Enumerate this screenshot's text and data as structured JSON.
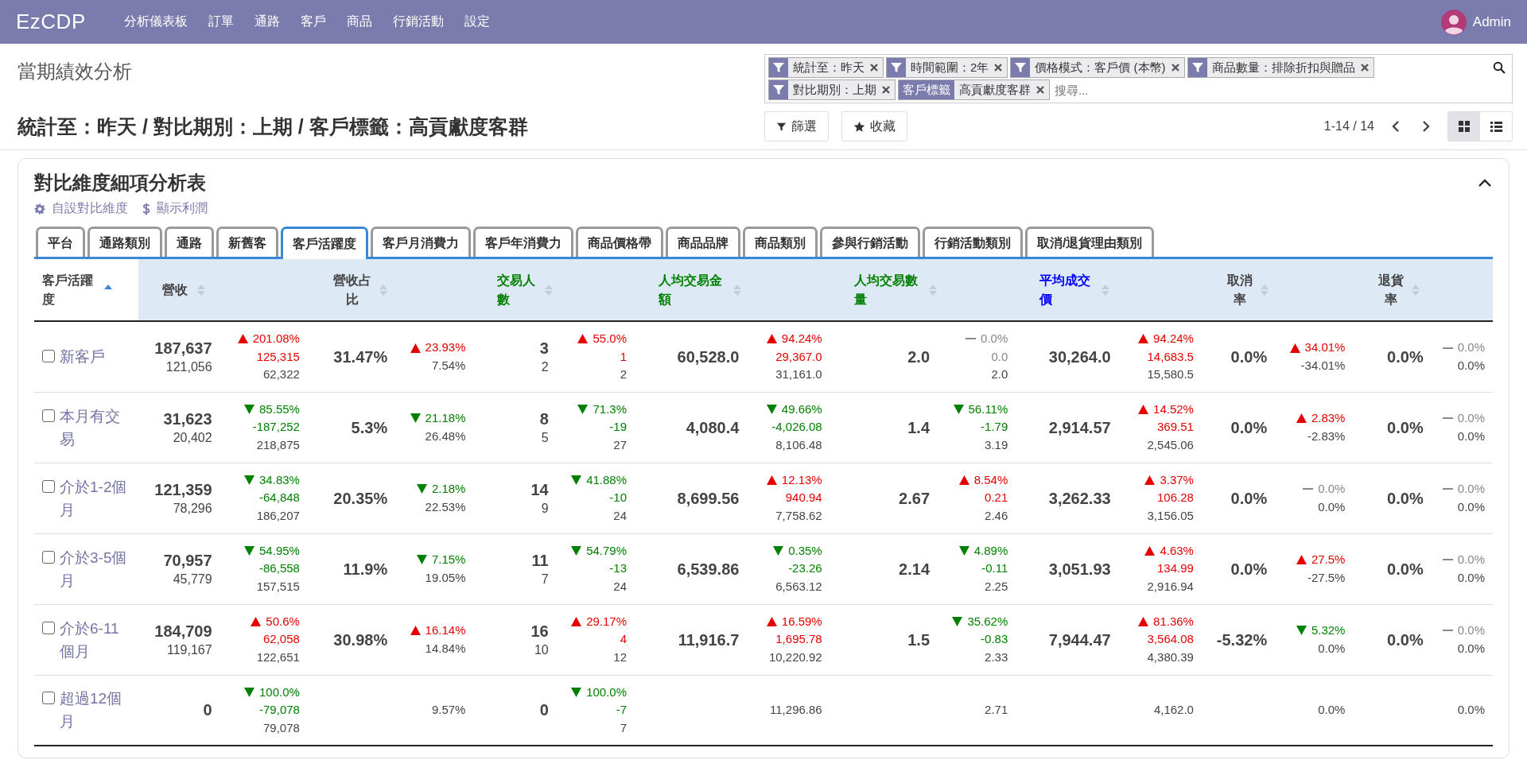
{
  "navbar": {
    "brand": "EzCDP",
    "menu": [
      "分析儀表板",
      "訂單",
      "通路",
      "客戶",
      "商品",
      "行銷活動",
      "設定"
    ],
    "user": "Admin"
  },
  "control_panel": {
    "title": "當期績效分析",
    "heading": "統計至：昨天 / 對比期別：上期 / 客戶標籤：高貢獻度客群",
    "facets": [
      {
        "kind": "filter",
        "text": "統計至：昨天"
      },
      {
        "kind": "filter",
        "text": "時間範圍：2年"
      },
      {
        "kind": "filter",
        "text": "價格模式：客戶價 (本幣)"
      },
      {
        "kind": "filter",
        "text": "商品數量：排除折扣與贈品"
      },
      {
        "kind": "filter",
        "text": "對比期別：上期"
      },
      {
        "kind": "tag",
        "label": "客戶標籤",
        "text": "高貢獻度客群"
      }
    ],
    "search_placeholder": "搜尋...",
    "buttons": [
      {
        "kind": "filter",
        "label": "篩選"
      },
      {
        "kind": "favorite",
        "label": "收藏"
      }
    ],
    "pager": "1-14 / 14",
    "views": [
      {
        "kind": "kanban",
        "selected": true
      },
      {
        "kind": "list",
        "selected": false
      }
    ]
  },
  "card": {
    "title": "對比維度細項分析表",
    "expanded": true,
    "links": [
      {
        "kind": "gear",
        "label": "自設對比維度"
      },
      {
        "kind": "dollar",
        "label": "顯示利潤"
      }
    ],
    "tabs": [
      {
        "label": "平台",
        "selected": false
      },
      {
        "label": "通路類別",
        "selected": false
      },
      {
        "label": "通路",
        "selected": false
      },
      {
        "label": "新舊客",
        "selected": false
      },
      {
        "label": "客戶活躍度",
        "selected": true
      },
      {
        "label": "客戶月消費力",
        "selected": false
      },
      {
        "label": "客戶年消費力",
        "selected": false
      },
      {
        "label": "商品價格帶",
        "selected": false
      },
      {
        "label": "商品品牌",
        "selected": false
      },
      {
        "label": "商品類別",
        "selected": false
      },
      {
        "label": "參與行銷活動",
        "selected": false
      },
      {
        "label": "行銷活動類別",
        "selected": false
      },
      {
        "label": "取消/退貨理由類別",
        "selected": false
      }
    ],
    "table": {
      "label_column": {
        "label": "客戶活躍度",
        "sorted": true
      },
      "columns": [
        {
          "label": "營收",
          "sorted": false,
          "color": "#444444"
        },
        {
          "label": "營收占比",
          "sorted": false,
          "color": "#444444"
        },
        {
          "label": "交易人數",
          "sorted": false,
          "color": "#008000"
        },
        {
          "label": "人均交易金額",
          "sorted": false,
          "color": "#008000"
        },
        {
          "label": "人均交易數量",
          "sorted": false,
          "color": "#008000"
        },
        {
          "label": "平均成交價",
          "sorted": false,
          "color": "#0000ff"
        },
        {
          "label": "取消率",
          "sorted": false,
          "color": "#444444"
        },
        {
          "label": "退貨率",
          "sorted": false,
          "color": "#444444"
        }
      ],
      "rows": [
        {
          "label": "新客戶",
          "checked": false,
          "cells": [
            {
              "main": "187,637",
              "sub": "121,056",
              "delta": {
                "kind": "up",
                "pct": "201.08%",
                "diff": "125,315",
                "prior": "62,322"
              }
            },
            {
              "main": "31.47%",
              "delta": {
                "kind": "up",
                "pct": "23.93%",
                "prior": "7.54%"
              }
            },
            {
              "main": "3",
              "sub": "2",
              "delta": {
                "kind": "up",
                "pct": "55.0%",
                "diff": "1",
                "prior": "2"
              }
            },
            {
              "main": "60,528.0",
              "delta": {
                "kind": "up",
                "pct": "94.24%",
                "diff": "29,367.0",
                "prior": "31,161.0"
              }
            },
            {
              "main": "2.0",
              "delta": {
                "kind": "flat",
                "pct": "0.0%",
                "diff": "0.0",
                "prior": "2.0"
              }
            },
            {
              "main": "30,264.0",
              "delta": {
                "kind": "up",
                "pct": "94.24%",
                "diff": "14,683.5",
                "prior": "15,580.5"
              }
            },
            {
              "main": "0.0%",
              "delta": {
                "kind": "up",
                "pct": "34.01%",
                "prior": "-34.01%"
              }
            },
            {
              "main": "0.0%",
              "delta": {
                "kind": "flat",
                "pct": "0.0%",
                "prior": "0.0%"
              }
            }
          ]
        },
        {
          "label": "本月有交易",
          "checked": false,
          "cells": [
            {
              "main": "31,623",
              "sub": "20,402",
              "delta": {
                "kind": "down",
                "pct": "85.55%",
                "diff": "-187,252",
                "prior": "218,875"
              }
            },
            {
              "main": "5.3%",
              "delta": {
                "kind": "down",
                "pct": "21.18%",
                "prior": "26.48%"
              }
            },
            {
              "main": "8",
              "sub": "5",
              "delta": {
                "kind": "down",
                "pct": "71.3%",
                "diff": "-19",
                "prior": "27"
              }
            },
            {
              "main": "4,080.4",
              "delta": {
                "kind": "down",
                "pct": "49.66%",
                "diff": "-4,026.08",
                "prior": "8,106.48"
              }
            },
            {
              "main": "1.4",
              "delta": {
                "kind": "down",
                "pct": "56.11%",
                "diff": "-1.79",
                "prior": "3.19"
              }
            },
            {
              "main": "2,914.57",
              "delta": {
                "kind": "up",
                "pct": "14.52%",
                "diff": "369.51",
                "prior": "2,545.06"
              }
            },
            {
              "main": "0.0%",
              "delta": {
                "kind": "up",
                "pct": "2.83%",
                "prior": "-2.83%"
              }
            },
            {
              "main": "0.0%",
              "delta": {
                "kind": "flat",
                "pct": "0.0%",
                "prior": "0.0%"
              }
            }
          ]
        },
        {
          "label": "介於1-2個月",
          "checked": false,
          "cells": [
            {
              "main": "121,359",
              "sub": "78,296",
              "delta": {
                "kind": "down",
                "pct": "34.83%",
                "diff": "-64,848",
                "prior": "186,207"
              }
            },
            {
              "main": "20.35%",
              "delta": {
                "kind": "down",
                "pct": "2.18%",
                "prior": "22.53%"
              }
            },
            {
              "main": "14",
              "sub": "9",
              "delta": {
                "kind": "down",
                "pct": "41.88%",
                "diff": "-10",
                "prior": "24"
              }
            },
            {
              "main": "8,699.56",
              "delta": {
                "kind": "up",
                "pct": "12.13%",
                "diff": "940.94",
                "prior": "7,758.62"
              }
            },
            {
              "main": "2.67",
              "delta": {
                "kind": "up",
                "pct": "8.54%",
                "diff": "0.21",
                "prior": "2.46"
              }
            },
            {
              "main": "3,262.33",
              "delta": {
                "kind": "up",
                "pct": "3.37%",
                "diff": "106.28",
                "prior": "3,156.05"
              }
            },
            {
              "main": "0.0%",
              "delta": {
                "kind": "flat",
                "pct": "0.0%",
                "prior": "0.0%"
              }
            },
            {
              "main": "0.0%",
              "delta": {
                "kind": "flat",
                "pct": "0.0%",
                "prior": "0.0%"
              }
            }
          ]
        },
        {
          "label": "介於3-5個月",
          "checked": false,
          "cells": [
            {
              "main": "70,957",
              "sub": "45,779",
              "delta": {
                "kind": "down",
                "pct": "54.95%",
                "diff": "-86,558",
                "prior": "157,515"
              }
            },
            {
              "main": "11.9%",
              "delta": {
                "kind": "down",
                "pct": "7.15%",
                "prior": "19.05%"
              }
            },
            {
              "main": "11",
              "sub": "7",
              "delta": {
                "kind": "down",
                "pct": "54.79%",
                "diff": "-13",
                "prior": "24"
              }
            },
            {
              "main": "6,539.86",
              "delta": {
                "kind": "down",
                "pct": "0.35%",
                "diff": "-23.26",
                "prior": "6,563.12"
              }
            },
            {
              "main": "2.14",
              "delta": {
                "kind": "down",
                "pct": "4.89%",
                "diff": "-0.11",
                "prior": "2.25"
              }
            },
            {
              "main": "3,051.93",
              "delta": {
                "kind": "up",
                "pct": "4.63%",
                "diff": "134.99",
                "prior": "2,916.94"
              }
            },
            {
              "main": "0.0%",
              "delta": {
                "kind": "up",
                "pct": "27.5%",
                "prior": "-27.5%"
              }
            },
            {
              "main": "0.0%",
              "delta": {
                "kind": "flat",
                "pct": "0.0%",
                "prior": "0.0%"
              }
            }
          ]
        },
        {
          "label": "介於6-11個月",
          "checked": false,
          "cells": [
            {
              "main": "184,709",
              "sub": "119,167",
              "delta": {
                "kind": "up",
                "pct": "50.6%",
                "diff": "62,058",
                "prior": "122,651"
              }
            },
            {
              "main": "30.98%",
              "delta": {
                "kind": "up",
                "pct": "16.14%",
                "prior": "14.84%"
              }
            },
            {
              "main": "16",
              "sub": "10",
              "delta": {
                "kind": "up",
                "pct": "29.17%",
                "diff": "4",
                "prior": "12"
              }
            },
            {
              "main": "11,916.7",
              "delta": {
                "kind": "up",
                "pct": "16.59%",
                "diff": "1,695.78",
                "prior": "10,220.92"
              }
            },
            {
              "main": "1.5",
              "delta": {
                "kind": "down",
                "pct": "35.62%",
                "diff": "-0.83",
                "prior": "2.33"
              }
            },
            {
              "main": "7,944.47",
              "delta": {
                "kind": "up",
                "pct": "81.36%",
                "diff": "3,564.08",
                "prior": "4,380.39"
              }
            },
            {
              "main": "-5.32%",
              "delta": {
                "kind": "down",
                "pct": "5.32%",
                "prior": "0.0%"
              }
            },
            {
              "main": "0.0%",
              "delta": {
                "kind": "flat",
                "pct": "0.0%",
                "prior": "0.0%"
              }
            }
          ]
        },
        {
          "label": "超過12個月",
          "checked": false,
          "cells": [
            {
              "main": "0",
              "delta": {
                "kind": "down",
                "pct": "100.0%",
                "diff": "-79,078",
                "prior": "79,078"
              }
            },
            {
              "delta": {
                "kind": "none",
                "prior": "9.57%"
              }
            },
            {
              "main": "0",
              "delta": {
                "kind": "down",
                "pct": "100.0%",
                "diff": "-7",
                "prior": "7"
              }
            },
            {
              "delta": {
                "kind": "none",
                "prior": "11,296.86"
              }
            },
            {
              "delta": {
                "kind": "none",
                "prior": "2.71"
              }
            },
            {
              "delta": {
                "kind": "none",
                "prior": "4,162.0"
              }
            },
            {
              "delta": {
                "kind": "none",
                "prior": "0.0%"
              }
            },
            {
              "delta": {
                "kind": "none",
                "prior": "0.0%"
              }
            }
          ]
        }
      ]
    }
  }
}
